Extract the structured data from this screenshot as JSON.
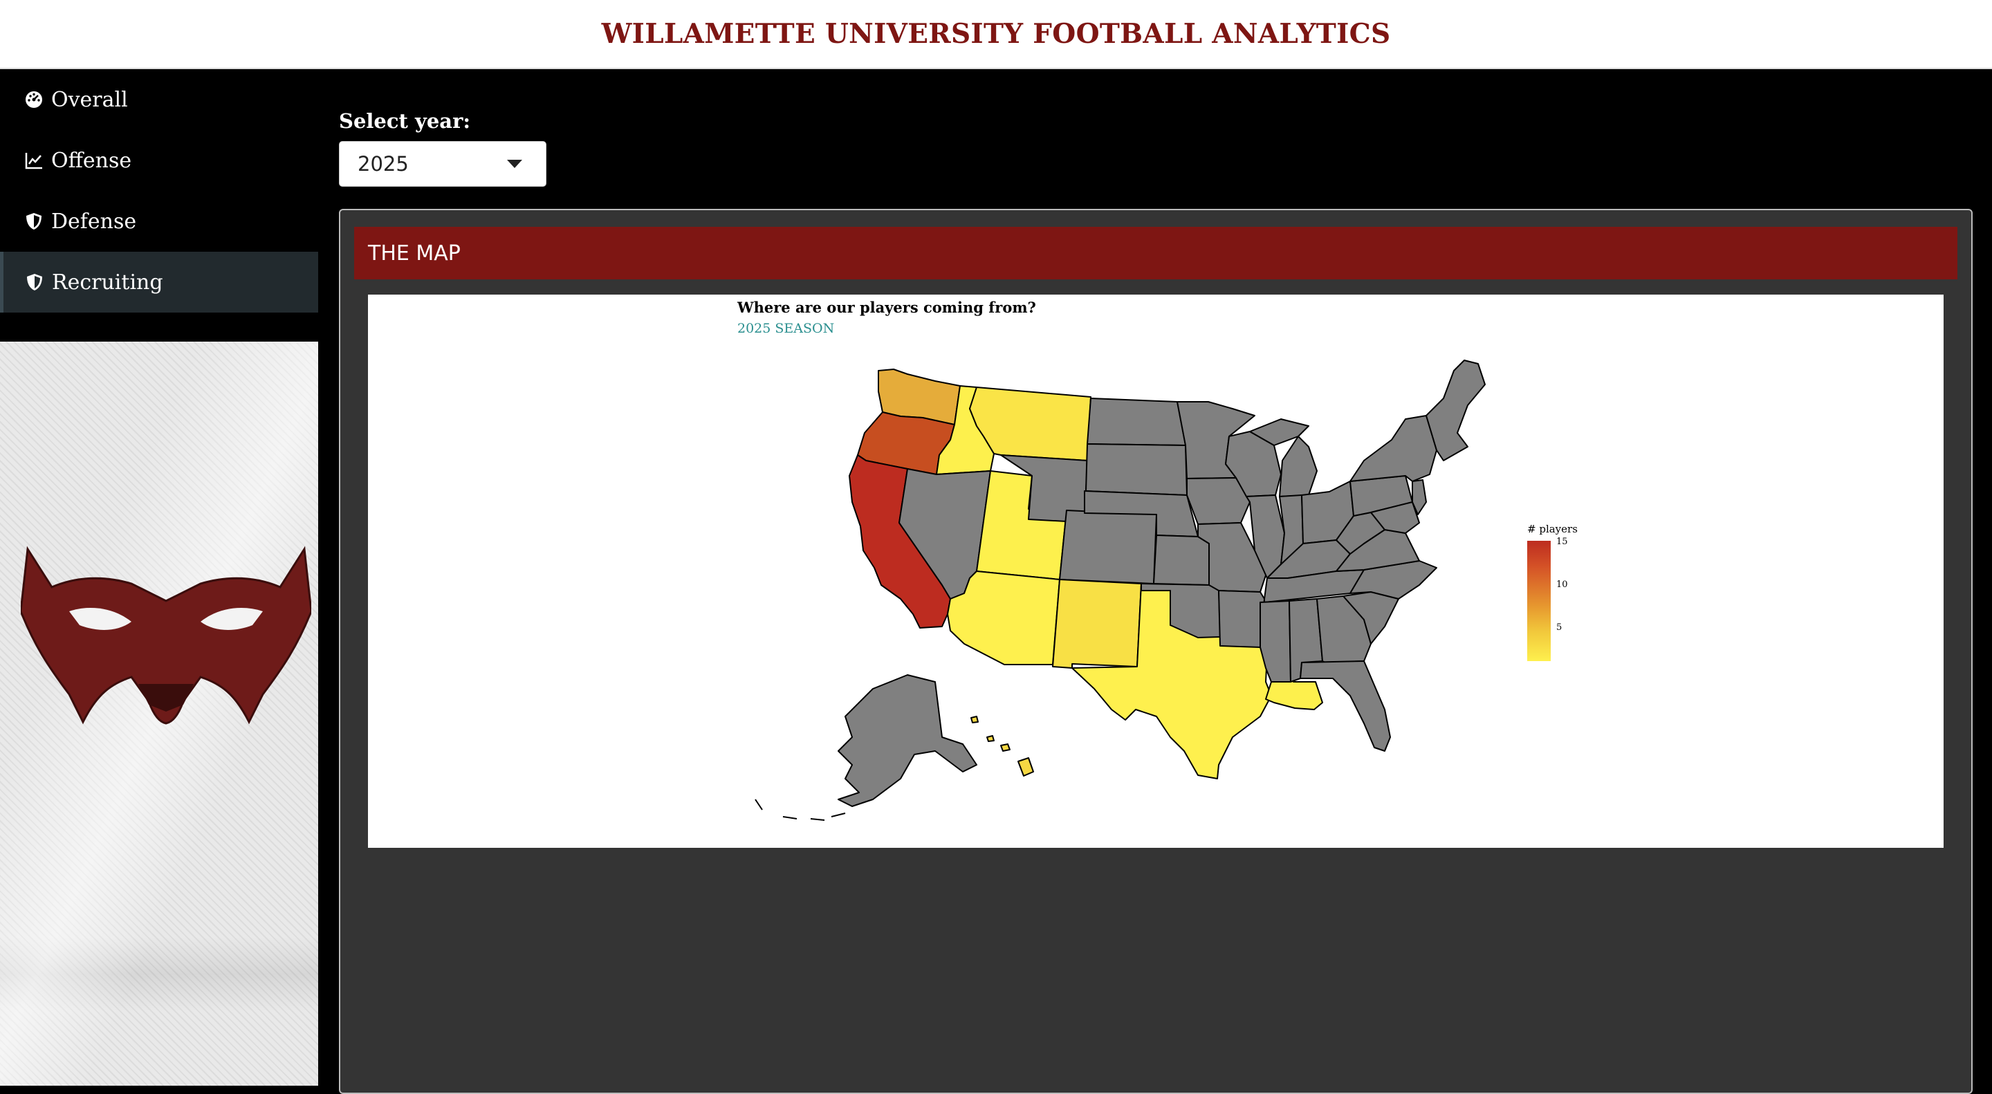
{
  "header": {
    "title": "WILLAMETTE UNIVERSITY FOOTBALL ANALYTICS"
  },
  "sidebar": {
    "items": [
      {
        "label": "Overall",
        "icon": "gauge-icon",
        "active": false
      },
      {
        "label": "Offense",
        "icon": "line-chart-icon",
        "active": false
      },
      {
        "label": "Defense",
        "icon": "shield-icon",
        "active": false
      },
      {
        "label": "Recruiting",
        "icon": "shield-icon",
        "active": true
      }
    ],
    "image": "bearcat-logo-on-jersey"
  },
  "filter": {
    "label": "Select year:",
    "selected": "2025"
  },
  "panel": {
    "title": "THE MAP"
  },
  "map": {
    "title": "Where are our players coming from?",
    "subtitle": "2025 SEASON",
    "legend": {
      "title": "# players",
      "ticks": [
        "15",
        "10",
        "5"
      ],
      "colors": [
        "#bd2c20",
        "#d55327",
        "#e7992f",
        "#f1c73b",
        "#fef04e"
      ]
    },
    "no_data_color": "#808080",
    "states": [
      {
        "name": "California",
        "players": 15
      },
      {
        "name": "Oregon",
        "players": 12
      },
      {
        "name": "Washington",
        "players": 7
      },
      {
        "name": "Montana",
        "players": 3
      },
      {
        "name": "Idaho",
        "players": 1
      },
      {
        "name": "Utah",
        "players": 1
      },
      {
        "name": "Arizona",
        "players": 1
      },
      {
        "name": "New Mexico",
        "players": 3
      },
      {
        "name": "Texas",
        "players": 1
      },
      {
        "name": "Louisiana",
        "players": 1
      },
      {
        "name": "Hawaii",
        "players": 3
      }
    ]
  }
}
